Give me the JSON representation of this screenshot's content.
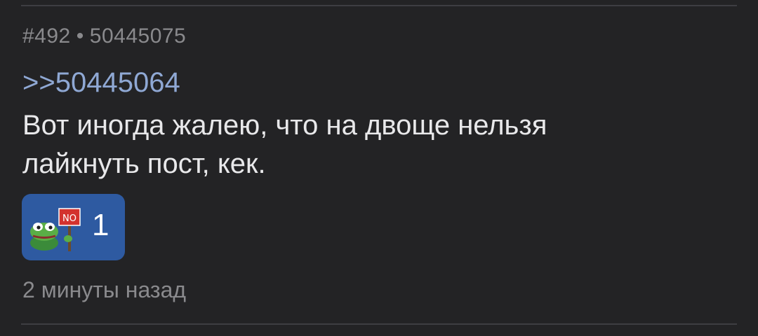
{
  "post": {
    "number": "#492",
    "separator": "•",
    "id": "50445075",
    "reply_to": ">>50445064",
    "text_lines": [
      "Вот иногда жалею, что на двоще нельзя",
      "лайкнуть пост, кек."
    ],
    "reaction": {
      "icon": "pepe-no-sign-icon",
      "sign_text": "NO",
      "count": "1",
      "color": "#2e5aa1"
    },
    "timestamp": "2 минуты назад"
  },
  "colors": {
    "background": "#232325",
    "meta_text": "#8a8a8d",
    "link": "#8fa8d4",
    "body_text": "#e8e8ea"
  }
}
